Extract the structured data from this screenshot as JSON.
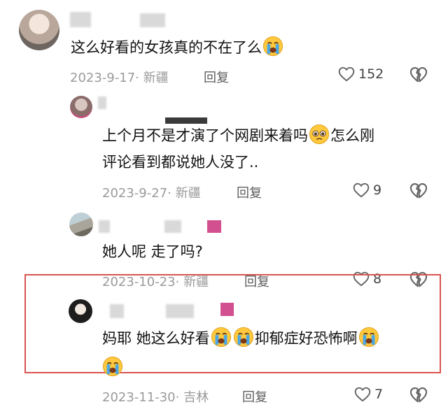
{
  "comments": [
    {
      "text": "这么好看的女孩真的不在了么",
      "date": "2023-9-17",
      "location": "新疆",
      "reply_label": "回复",
      "likes": "152"
    },
    {
      "text_line1": "上个月不是才演了个网剧来着吗",
      "text_line1_tail": "怎么刚",
      "text_line2": "评论看到都说她人没了..",
      "date": "2023-9-27",
      "location": "新疆",
      "reply_label": "回复",
      "likes": "9"
    },
    {
      "text": "她人呢  走了吗?",
      "date": "2023-10-23",
      "location": "新疆",
      "reply_label": "回复",
      "likes": "8"
    },
    {
      "text_a": "妈耶 她这么好看",
      "text_b": "抑郁症好恐怖啊",
      "date": "2023-11-30",
      "location": "吉林",
      "reply_label": "回复",
      "likes": "7"
    }
  ],
  "separator": "·",
  "colors": {
    "highlight": "#d9534f",
    "meta": "#9a9a9a",
    "pink_block": "#d2508f"
  },
  "icons": [
    "heart-outline-icon",
    "broken-heart-icon",
    "crying-face-icon",
    "pleading-face-icon"
  ]
}
